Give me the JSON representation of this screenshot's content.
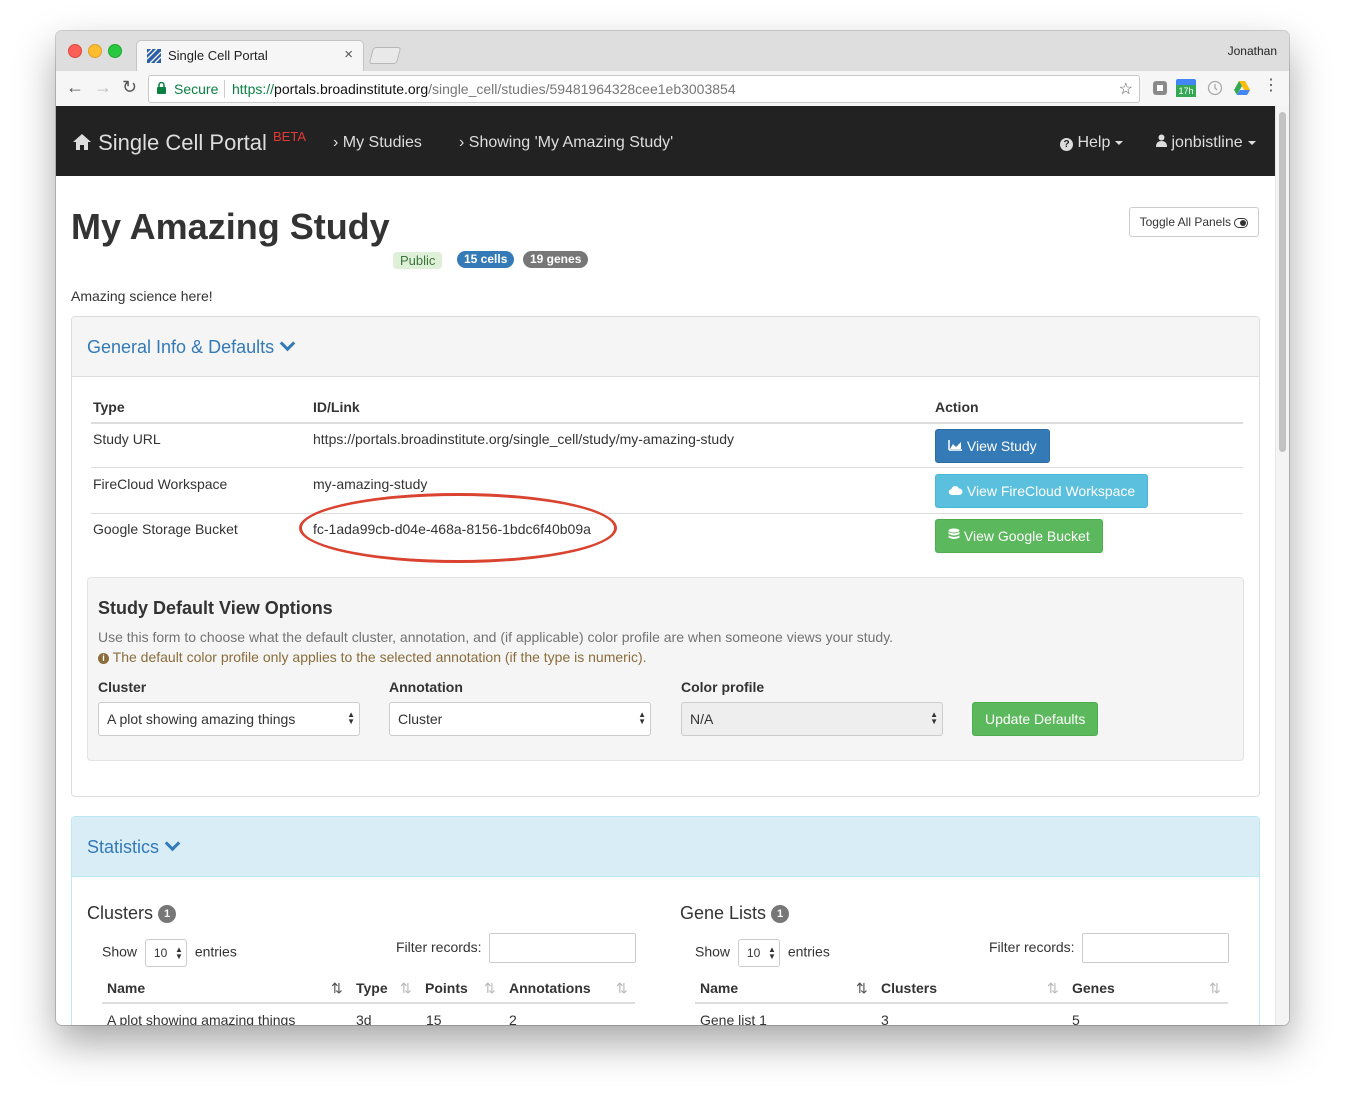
{
  "browser": {
    "tab_title": "Single Cell Portal",
    "profile": "Jonathan",
    "secure_label": "Secure",
    "url_scheme": "https://",
    "url_host": "portals.broadinstitute.org",
    "url_path": "/single_cell/studies/59481964328cee1eb3003854",
    "ext_badge": "17h"
  },
  "navbar": {
    "brand": "Single Cell Portal",
    "beta": "BETA",
    "crumb1": "My Studies",
    "crumb2": "Showing 'My Amazing Study'",
    "help": "Help",
    "user": "jonbistline"
  },
  "study": {
    "title": "My Amazing Study",
    "visibility": "Public",
    "cells": "15 cells",
    "genes": "19 genes",
    "description": "Amazing science here!",
    "toggle_panels": "Toggle All Panels"
  },
  "general_panel": {
    "title": "General Info & Defaults",
    "headers": [
      "Type",
      "ID/Link",
      "Action"
    ],
    "rows": [
      {
        "type": "Study URL",
        "link": "https://portals.broadinstitute.org/single_cell/study/my-amazing-study",
        "action": "View Study"
      },
      {
        "type": "FireCloud Workspace",
        "link": "my-amazing-study",
        "action": "View FireCloud Workspace"
      },
      {
        "type": "Google Storage Bucket",
        "link": "fc-1ada99cb-d04e-468a-8156-1bdc6f40b09a",
        "action": "View Google Bucket"
      }
    ]
  },
  "defaults_form": {
    "title": "Study Default View Options",
    "help": "Use this form to choose what the default cluster, annotation, and (if applicable) color profile are when someone views your study.",
    "warning": "The default color profile only applies to the selected annotation (if the type is numeric).",
    "cluster_label": "Cluster",
    "cluster_value": "A plot showing amazing things",
    "annotation_label": "Annotation",
    "annotation_value": "Cluster",
    "color_label": "Color profile",
    "color_value": "N/A",
    "submit": "Update Defaults"
  },
  "stats_panel": {
    "title": "Statistics",
    "clusters": {
      "title": "Clusters",
      "count": "1",
      "show": "Show",
      "length": "10",
      "entries": "entries",
      "filter": "Filter records:",
      "headers": [
        "Name",
        "Type",
        "Points",
        "Annotations"
      ],
      "row": [
        "A plot showing amazing things",
        "3d",
        "15",
        "2"
      ]
    },
    "genes": {
      "title": "Gene Lists",
      "count": "1",
      "show": "Show",
      "length": "10",
      "entries": "entries",
      "filter": "Filter records:",
      "headers": [
        "Name",
        "Clusters",
        "Genes"
      ],
      "row": [
        "Gene list 1",
        "3",
        "5"
      ]
    }
  },
  "colors": {
    "primary": "#337ab7",
    "info": "#5bc0de",
    "success": "#5cb85c",
    "navbar": "#222222",
    "highlight_oval": "#d9432f"
  }
}
